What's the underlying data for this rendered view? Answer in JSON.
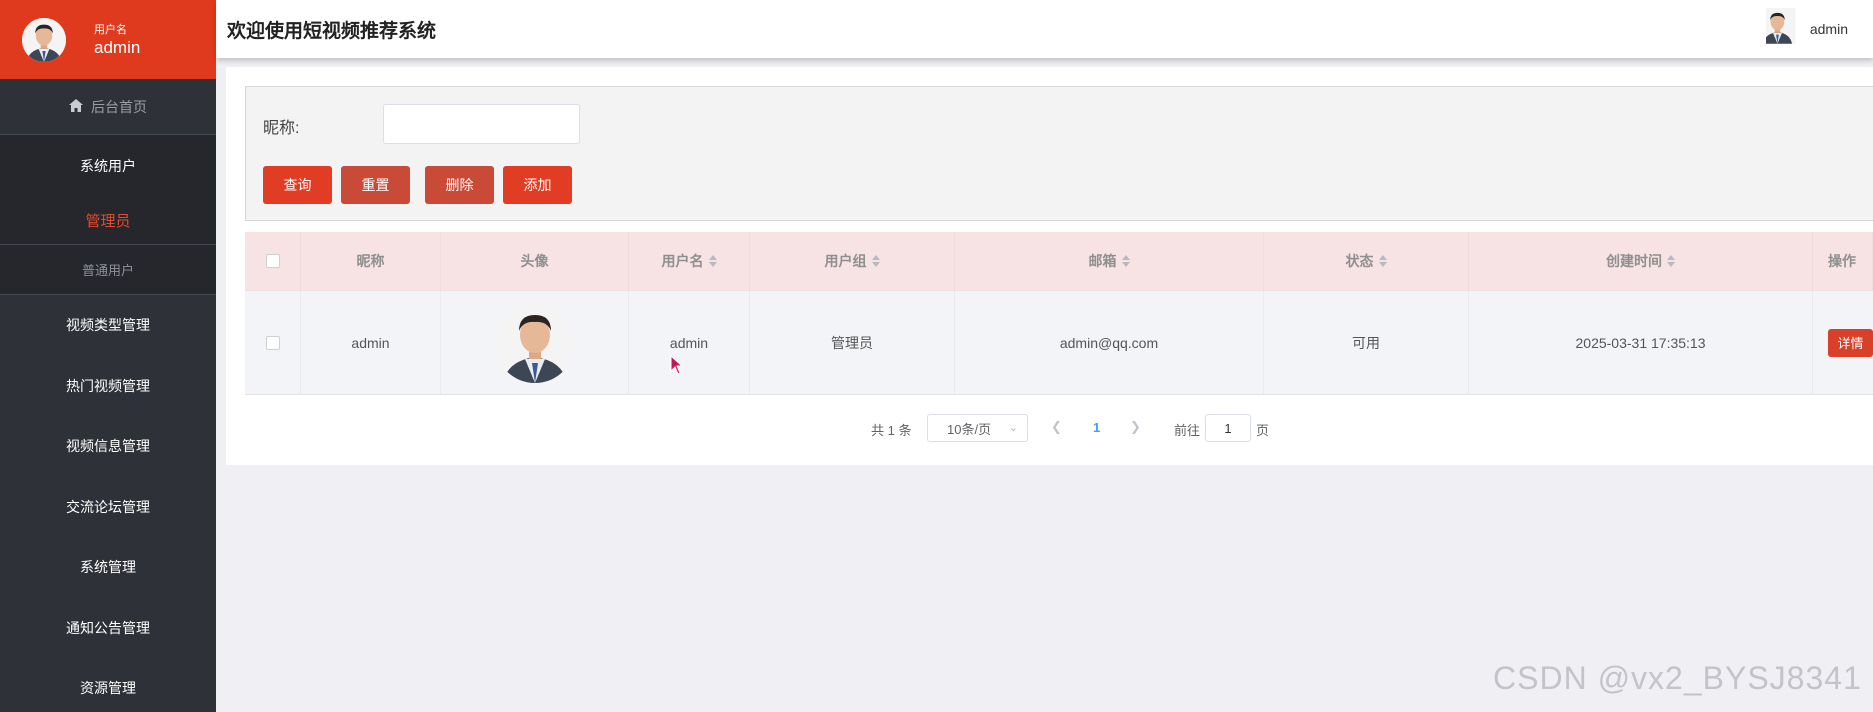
{
  "sidebar": {
    "user_label": "用户名",
    "user_name": "admin",
    "home": "后台首页",
    "group_title": "系统用户",
    "sub_active": "管理员",
    "sub_other": "普通用户",
    "items": [
      {
        "label": "视频类型管理"
      },
      {
        "label": "热门视频管理"
      },
      {
        "label": "视频信息管理"
      },
      {
        "label": "交流论坛管理"
      },
      {
        "label": "系统管理"
      },
      {
        "label": "通知公告管理"
      },
      {
        "label": "资源管理"
      }
    ]
  },
  "header": {
    "title": "欢迎使用短视频推荐系统",
    "user_name": "admin"
  },
  "search": {
    "nickname_label": "昵称:",
    "nickname_value": "",
    "buttons": {
      "query": "查询",
      "reset": "重置",
      "delete": "删除",
      "add": "添加"
    }
  },
  "table": {
    "columns": {
      "nickname": "昵称",
      "avatar": "头像",
      "username": "用户名",
      "group": "用户组",
      "email": "邮箱",
      "status": "状态",
      "created": "创建时间",
      "action": "操作"
    },
    "rows": [
      {
        "nickname": "admin",
        "username": "admin",
        "group": "管理员",
        "email": "admin@qq.com",
        "status": "可用",
        "created": "2025-03-31 17:35:13",
        "action": "详情"
      }
    ]
  },
  "pagination": {
    "total": "共 1 条",
    "page_size": "10条/页",
    "current_page": "1",
    "goto_label": "前往",
    "goto_value": "1",
    "page_suffix": "页"
  },
  "watermark": "CSDN @vx2_BYSJ8341",
  "colors": {
    "accent": "#e03a1e",
    "sidebar": "#2f3138",
    "table_header": "#f7e3e4"
  }
}
